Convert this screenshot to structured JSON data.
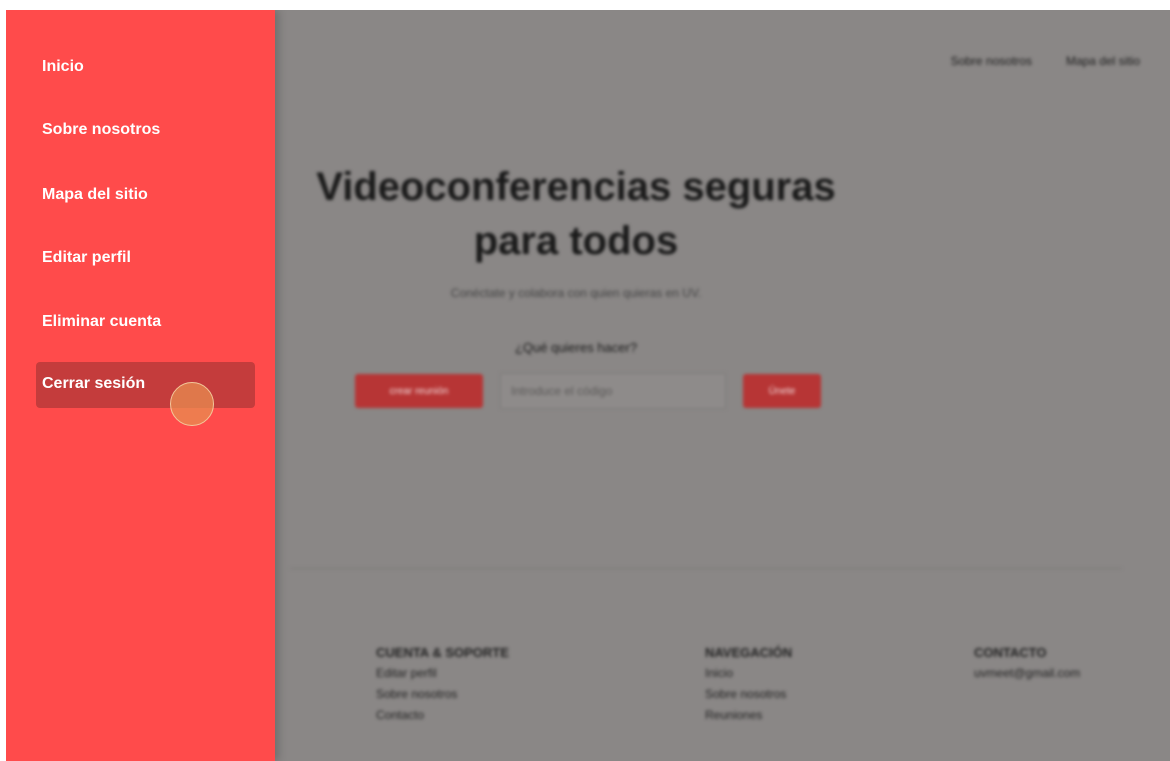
{
  "sidebar": {
    "items": [
      {
        "label": "Inicio"
      },
      {
        "label": "Sobre nosotros"
      },
      {
        "label": "Mapa del sitio"
      },
      {
        "label": "Editar perfil"
      },
      {
        "label": "Eliminar cuenta"
      },
      {
        "label": "Cerrar sesión"
      }
    ],
    "active_index": 5
  },
  "topnav": {
    "items": [
      "Sobre nosotros",
      "Mapa del sitio"
    ]
  },
  "hero": {
    "title_line1": "Videoconferencias seguras",
    "title_line2": "para todos",
    "subtitle": "Conéctate y colabora con quien quieras en UV.",
    "question": "¿Qué quieres hacer?",
    "create_button": "crear reunión",
    "code_placeholder": "Introduce el código",
    "join_button": "Únete"
  },
  "footer": {
    "columns": [
      {
        "heading": "CUENTA & SOPORTE",
        "links": [
          "Editar perfil",
          "Sobre nosotros",
          "Contacto"
        ]
      },
      {
        "heading": "NAVEGACIÓN",
        "links": [
          "Inicio",
          "Sobre nosotros",
          "Reuniones"
        ]
      },
      {
        "heading": "CONTACTO",
        "links": [
          "uvmeet@gmail.com"
        ]
      }
    ]
  },
  "colors": {
    "sidebar_bg": "#ff4b4b",
    "sidebar_active": "#c43c3c",
    "overlay_bg": "#8a8786",
    "button_bg": "#b73535"
  }
}
